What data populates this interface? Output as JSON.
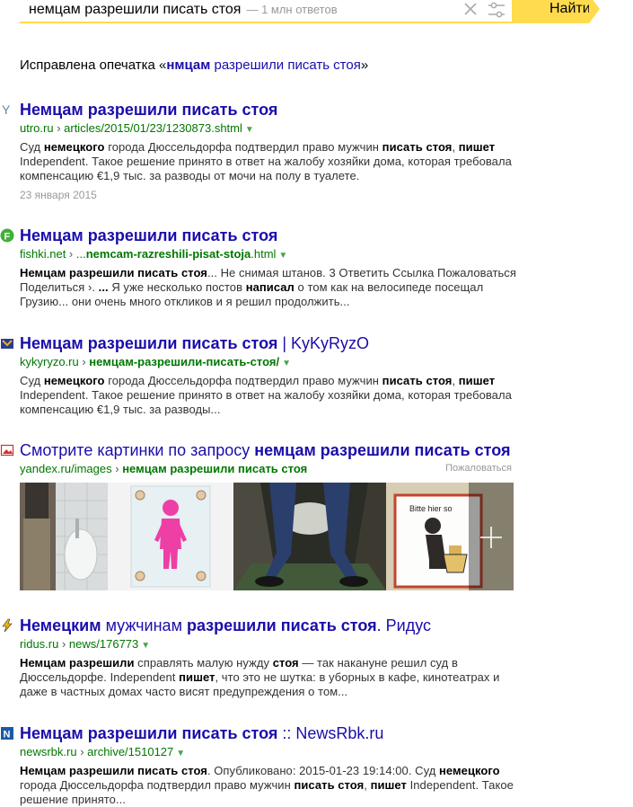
{
  "search": {
    "query": "немцам разрешили писать стоя",
    "count": "— 1 млн ответов",
    "button_label": "Найти"
  },
  "spellfix": {
    "prefix": "Исправлена опечатка «",
    "fixed_word": "нмцам",
    "rest": " разрешили писать стоя",
    "suffix": "»"
  },
  "results": [
    {
      "title_bold": "Немцам разрешили писать стоя",
      "title_rest": "",
      "host": "utro.ru",
      "path": "articles/2015/01/23/1230873.shtml",
      "snippet_parts": [
        {
          "t": "Суд ",
          "b": false
        },
        {
          "t": "немецкого",
          "b": true
        },
        {
          "t": " города Дюссельдорфа подтвердил право мужчин ",
          "b": false
        },
        {
          "t": "писать стоя",
          "b": true
        },
        {
          "t": ", ",
          "b": false
        },
        {
          "t": "пишет",
          "b": true
        },
        {
          "t": " Independent. Такое решение принято в ответ на жалобу хозяйки дома, которая требовала компенсацию €1,9 тыс. за разводы от мочи на полу в туалете.",
          "b": false
        }
      ],
      "date": "23 января 2015"
    },
    {
      "title_bold": "Немцам разрешили писать стоя",
      "title_rest": "",
      "host": "fishki.net",
      "path_prefix": "...",
      "path": "nemcam-razreshili-pisat-stoja",
      "path_suffix": ".html",
      "snippet_parts": [
        {
          "t": "Немцам разрешили писать стоя",
          "b": true
        },
        {
          "t": "... Не снимая штанов. 3 Ответить Ссылка Пожаловаться Поделиться ›. ",
          "b": false
        },
        {
          "t": "...",
          "b": true
        },
        {
          "t": " Я уже несколько постов ",
          "b": false
        },
        {
          "t": "написал",
          "b": true
        },
        {
          "t": " о том как на велосипеде посещал Грузию... они очень много откликов и я решил продолжить...",
          "b": false
        }
      ]
    },
    {
      "title_bold": "Немцам разрешили писать стоя",
      "title_rest": " | KyKyRyzO",
      "host": "kykyryzo.ru",
      "path": "немцам-разрешили-писать-стоя/",
      "snippet_parts": [
        {
          "t": "Суд ",
          "b": false
        },
        {
          "t": "немецкого",
          "b": true
        },
        {
          "t": " города Дюссельдорфа подтвердил право мужчин ",
          "b": false
        },
        {
          "t": "писать стоя",
          "b": true
        },
        {
          "t": ", ",
          "b": false
        },
        {
          "t": "пишет",
          "b": true
        },
        {
          "t": " Independent. Такое решение принято в ответ на жалобу хозяйки дома, которая требовала компенсацию €1,9 тыс. за разводы...",
          "b": false
        }
      ]
    },
    {
      "title_pre": "Немецким",
      "title_mid": " мужчинам ",
      "title_bold": "разрешили писать стоя",
      "title_rest": ". Ридус",
      "host": "ridus.ru",
      "path": "news/176773",
      "snippet_parts": [
        {
          "t": "Немцам разрешили",
          "b": true
        },
        {
          "t": " справлять малую нужду ",
          "b": false
        },
        {
          "t": "стоя",
          "b": true
        },
        {
          "t": " — так накануне решил суд в Дюссельдорфе. Independent ",
          "b": false
        },
        {
          "t": "пишет",
          "b": true
        },
        {
          "t": ", что это не шутка: в уборных в кафе, кинотеатрах и даже в частных домах часто висят предупреждения о том...",
          "b": false
        }
      ]
    },
    {
      "title_bold": "Немцам разрешили писать стоя",
      "title_rest": " :: NewsRbk.ru",
      "host": "newsrbk.ru",
      "path": "archive/1510127",
      "snippet_parts": [
        {
          "t": "Немцам разрешили писать стоя",
          "b": true
        },
        {
          "t": ". Опубликовано: 2015-01-23 19:14:00. Суд ",
          "b": false
        },
        {
          "t": "немецкого",
          "b": true
        },
        {
          "t": " города Дюссельдорфа подтвердил право мужчин ",
          "b": false
        },
        {
          "t": "писать стоя",
          "b": true
        },
        {
          "t": ", ",
          "b": false
        },
        {
          "t": "пишет",
          "b": true
        },
        {
          "t": " Independent. Такое решение принято...",
          "b": false
        }
      ]
    }
  ],
  "images": {
    "title_prefix": "Смотрите картинки по запросу ",
    "title_bold": "немцам разрешили писать стоя",
    "host": "yandex.ru/images",
    "path": "немцам разрешили писать стоя",
    "complain": "Пожаловаться",
    "sign_text": "Bitte hier so"
  },
  "colors": {
    "link": "#1a0dab",
    "url_green": "#007700",
    "accent_yellow": "#ffdb4d"
  }
}
